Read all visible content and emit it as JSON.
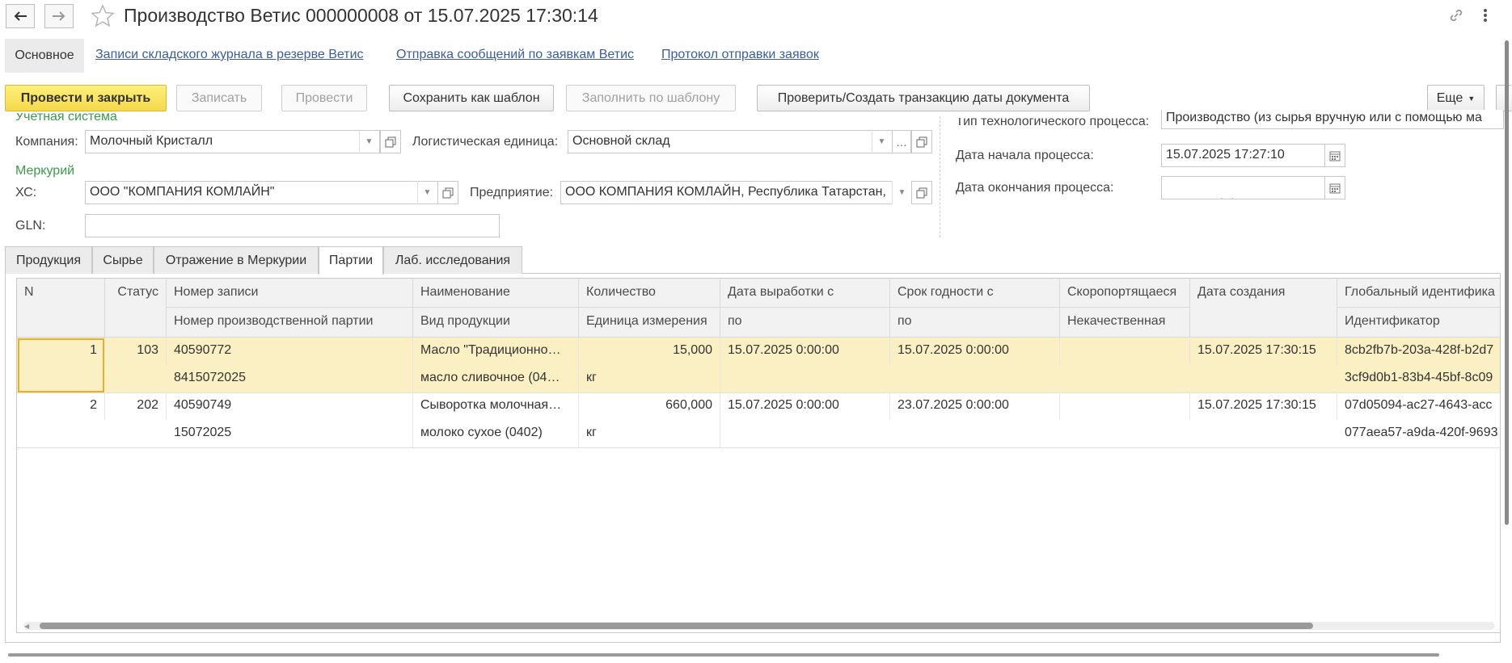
{
  "window": {
    "title": "Производство Ветис 000000008 от 15.07.2025 17:30:14"
  },
  "sections": {
    "active": "Основное",
    "links": [
      "Записи складского журнала в резерве Ветис",
      "Отправка сообщений по заявкам Ветис",
      "Протокол отправки заявок"
    ]
  },
  "toolbar": {
    "post_close": "Провести и закрыть",
    "save": "Записать",
    "post": "Провести",
    "save_template": "Сохранить как шаблон",
    "fill_template": "Заполнить по шаблону",
    "check_tx": "Проверить/Создать транзакцию даты документа",
    "more": "Еще"
  },
  "form": {
    "group_accounting": "Учетная система",
    "company_label": "Компания:",
    "company_value": "Молочный Кристалл",
    "logistic_label": "Логистическая единица:",
    "logistic_value": "Основной склад",
    "group_mercury": "Меркурий",
    "hs_label": "ХС:",
    "hs_value": "ООО \"КОМПАНИЯ КОМЛАЙН\"",
    "enterprise_label": "Предприятие:",
    "enterprise_value": "ООО КОМПАНИЯ КОМЛАЙН, Республика Татарстан,",
    "gln_label": "GLN:",
    "gln_value": "",
    "process_type_label": "Тип технологического процесса:",
    "process_type_value": "Производство (из сырья вручную или с помощью ма",
    "start_label": "Дата начала процесса:",
    "start_value": "15.07.2025 17:27:10",
    "end_label": "Дата окончания процесса:",
    "end_value": "  .  .       :  :  "
  },
  "tabs": [
    "Продукция",
    "Сырье",
    "Отражение в Меркурии",
    "Партии",
    "Лаб. исследования"
  ],
  "table": {
    "headers_top": [
      "N",
      "Статус",
      "Номер записи",
      "Наименование",
      "Количество",
      "Дата выработки с",
      "Срок годности с",
      "Скоропортящаеся",
      "Дата создания",
      "Глобальный идентифика"
    ],
    "headers_bottom": [
      "",
      "",
      "Номер производственной партии",
      "Вид продукции",
      "Единица измерения",
      "по",
      "по",
      "Некачественная",
      "",
      "Идентификатор"
    ],
    "rows": [
      {
        "top": [
          "1",
          "103",
          "40590772",
          "Масло \"Традиционно…",
          "15,000",
          "15.07.2025 0:00:00",
          "15.07.2025 0:00:00",
          "",
          "15.07.2025 17:30:15",
          "8cb2fb7b-203a-428f-b2d7"
        ],
        "bottom": [
          "",
          "",
          "8415072025",
          "масло сливочное (04…",
          "кг",
          "",
          "",
          "",
          "",
          "3cf9d0b1-83b4-45bf-8c09"
        ]
      },
      {
        "top": [
          "2",
          "202",
          "40590749",
          "Сыворотка молочная…",
          "660,000",
          "15.07.2025 0:00:00",
          "23.07.2025 0:00:00",
          "",
          "15.07.2025 17:30:15",
          "07d05094-ac27-4643-acc"
        ],
        "bottom": [
          "",
          "",
          "15072025",
          "молоко сухое (0402)",
          "кг",
          "",
          "",
          "",
          "",
          "077aea57-a9da-420f-9693"
        ]
      }
    ]
  },
  "colors": {
    "accent_yellow": "#f5d94b",
    "selected_row": "#fbf0c4",
    "link": "#3c5d9c",
    "group_green": "#3c9a4a"
  }
}
